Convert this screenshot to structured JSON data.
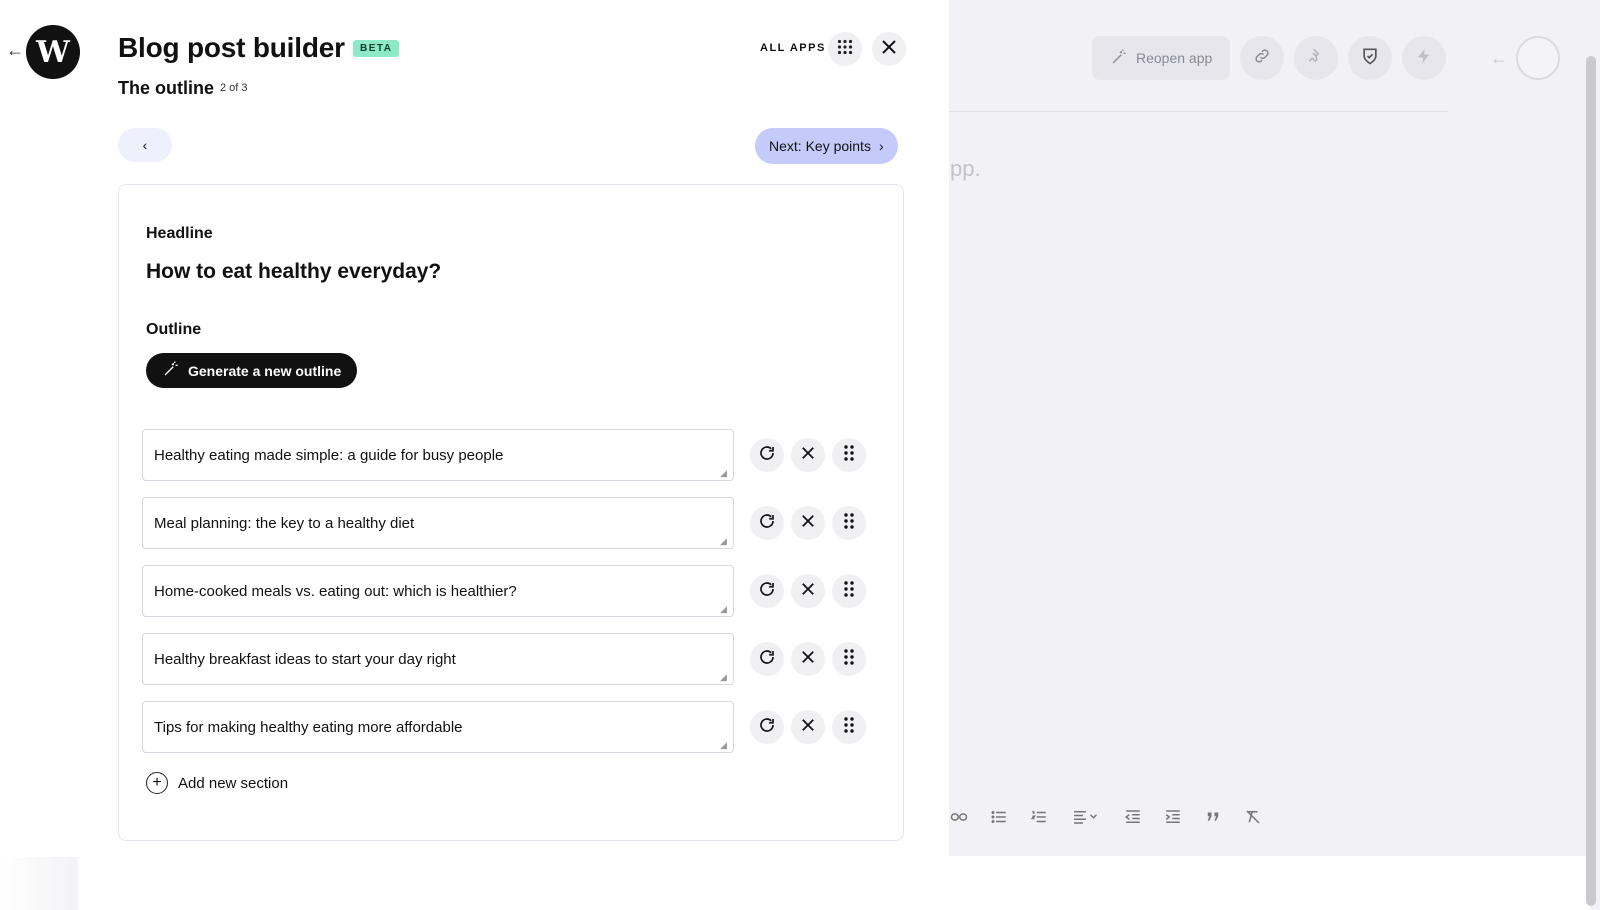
{
  "app": {
    "title": "Blog post builder",
    "badge": "BETA",
    "step_title": "The outline",
    "step_count": "2 of 3",
    "all_apps_label": "ALL APPS"
  },
  "nav": {
    "prev_label": "‹",
    "next_label": "Next: Key points",
    "next_chevron": "›"
  },
  "card": {
    "headline_label": "Headline",
    "headline_text": "How to eat healthy everyday?",
    "outline_label": "Outline",
    "generate_label": "Generate a new outline",
    "sections": [
      "Healthy eating made simple: a guide for busy people",
      "Meal planning: the key to a healthy diet",
      "Home-cooked meals vs. eating out: which is healthier?",
      "Healthy breakfast ideas to start your day right",
      "Tips for making healthy eating more affordable"
    ],
    "add_section_label": "Add new section"
  },
  "background_editor": {
    "reopen_label": "Reopen app",
    "placeholder_tail": "pp."
  },
  "icons": {
    "logo_letter": "W",
    "back": "←",
    "plus": "+"
  }
}
